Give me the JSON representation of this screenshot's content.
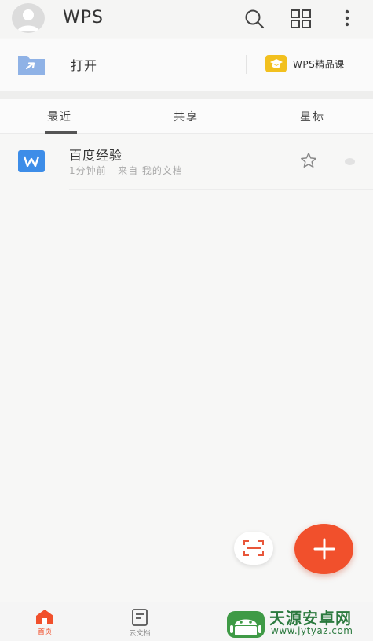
{
  "header": {
    "logo": "WPS",
    "icons": [
      "avatar",
      "search-icon",
      "grid-icon",
      "more-vert-icon"
    ]
  },
  "open_row": {
    "open_label": "打开",
    "course_label": "WPS精品课"
  },
  "tabs": [
    {
      "label": "最近",
      "active": true
    },
    {
      "label": "共享",
      "active": false
    },
    {
      "label": "星标",
      "active": false
    }
  ],
  "files": [
    {
      "title": "百度经验",
      "meta": "1分钟前   来自 我的文档"
    }
  ],
  "bottom_nav": [
    {
      "label": "首页",
      "active": true
    },
    {
      "label": "云文档",
      "active": false
    }
  ],
  "watermark": {
    "text": "天源安卓网",
    "url": "www.jytyaz.com"
  },
  "colors": {
    "accent": "#f1502c",
    "doc_blue": "#3d8de8",
    "course_yellow": "#f2c01e"
  }
}
